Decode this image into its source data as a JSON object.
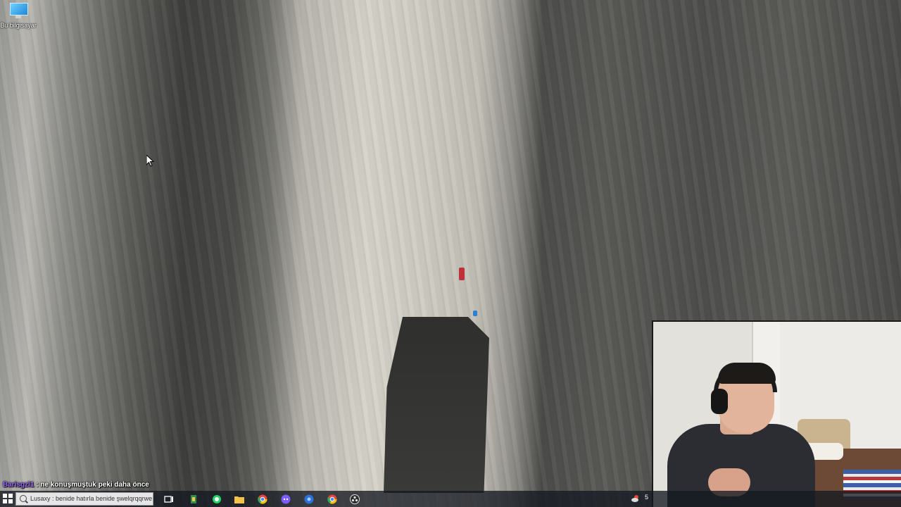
{
  "desktop": {
    "icons": [
      {
        "label": "Bu bilgisayar",
        "icon": "this-pc-icon"
      }
    ]
  },
  "chat": {
    "username": "Barisgzl1",
    "message": " : ne konuşmuştuk peki daha önce"
  },
  "taskbar": {
    "search_text": "Lusaxy : benide hatırla benide şwelqrqqrwe",
    "pinned": [
      {
        "name": "task-view-icon",
        "color": "#ffffff"
      },
      {
        "name": "app-green-icon",
        "color": "#2d8f4e"
      },
      {
        "name": "whatsapp-icon",
        "color": "#25d366"
      },
      {
        "name": "file-explorer-icon",
        "color": "#f3c34a"
      },
      {
        "name": "chrome-icon",
        "color": "#e8453c"
      },
      {
        "name": "discord-icon",
        "color": "#7c5cff"
      },
      {
        "name": "settings-app-icon",
        "color": "#2e6fd8"
      },
      {
        "name": "chrome-alt-icon",
        "color": "#e8453c"
      },
      {
        "name": "obs-icon",
        "color": "#2b2b2b"
      }
    ],
    "tray": {
      "weather_icon": "weather-icon",
      "temperature": "5"
    }
  },
  "colors": {
    "chat_username": "#9c6cff",
    "taskbar_bg": "#14182099"
  }
}
